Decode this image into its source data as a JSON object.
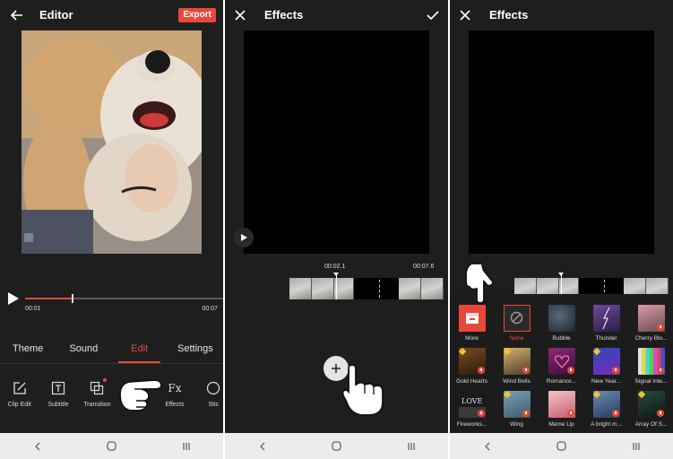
{
  "editor": {
    "title": "Editor",
    "export_label": "Export",
    "time_current": "00:01",
    "time_total": "00:07",
    "progress": 0.24,
    "tabs": [
      {
        "label": "Theme",
        "active": false
      },
      {
        "label": "Sound",
        "active": false
      },
      {
        "label": "Edit",
        "active": true
      },
      {
        "label": "Settings",
        "active": false
      }
    ],
    "tools": [
      {
        "label": "Clip Edit",
        "icon": "clip-edit-icon"
      },
      {
        "label": "Subtitle",
        "icon": "subtitle-icon"
      },
      {
        "label": "Transition",
        "icon": "transition-icon"
      },
      {
        "label": "ter",
        "icon": "filter-icon"
      },
      {
        "label": "Effects",
        "icon": "effects-icon"
      },
      {
        "label": "Stic",
        "icon": "sticker-icon"
      }
    ]
  },
  "effects_timeline": {
    "title": "Effects",
    "time_current": "00:02.1",
    "time_total": "00:07.6"
  },
  "effects_picker": {
    "title": "Effects",
    "items": [
      {
        "label": "More",
        "selected": false
      },
      {
        "label": "None",
        "selected": true
      },
      {
        "label": "Bubble",
        "selected": false
      },
      {
        "label": "Thunder",
        "selected": false
      },
      {
        "label": "Cherry Blo...",
        "selected": false
      },
      {
        "label": "Gold Hearts",
        "selected": false
      },
      {
        "label": "Wind Bells",
        "selected": false
      },
      {
        "label": "Romance...",
        "selected": false
      },
      {
        "label": "New Year...",
        "selected": false
      },
      {
        "label": "Signal Inte...",
        "selected": false
      },
      {
        "label": "Fireworks...",
        "selected": false
      },
      {
        "label": "Wing",
        "selected": false
      },
      {
        "label": "Meme Lip",
        "selected": false
      },
      {
        "label": "A bright m...",
        "selected": false
      },
      {
        "label": "Array Of S...",
        "selected": false
      }
    ]
  },
  "colors": {
    "accent": "#e8483a",
    "background": "#1e1e1e",
    "navbar": "#ececec"
  }
}
